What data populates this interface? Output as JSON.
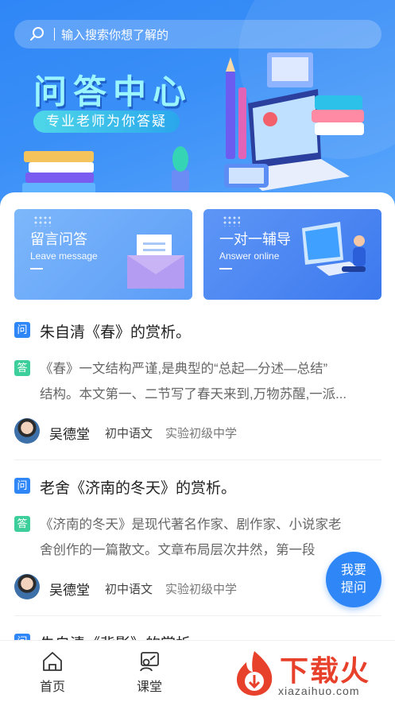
{
  "search": {
    "placeholder": "输入搜索你想了解的"
  },
  "hero": {
    "title": "问答中心",
    "subtitle": "专业老师为你答疑"
  },
  "entries": [
    {
      "title": "留言问答",
      "subtitle": "Leave message"
    },
    {
      "title": "一对一辅导",
      "subtitle": "Answer online"
    }
  ],
  "badges": {
    "ask": "问",
    "answer": "答"
  },
  "questions": [
    {
      "title": "朱自清《春》的赏析。",
      "answer_line1": "《春》一文结构严谨,是典型的“总起—分述—总结”",
      "answer_line2": "结构。本文第一、二节写了春天来到,万物苏醒,一派...",
      "teacher": "吴德堂",
      "subject": "初中语文",
      "school": "实验初级中学"
    },
    {
      "title": "老舍《济南的冬天》的赏析。",
      "answer_line1": "《济南的冬天》是现代著名作家、剧作家、小说家老",
      "answer_line2": "舍创作的一篇散文。文章布局层次井然，第一段",
      "teacher": "吴德堂",
      "subject": "初中语文",
      "school": "实验初级中学"
    },
    {
      "title": "朱自清《背影》的赏析"
    }
  ],
  "fab": {
    "line1": "我要",
    "line2": "提问"
  },
  "tabbar": {
    "items": [
      {
        "label": "首页"
      },
      {
        "label": "课堂"
      }
    ]
  },
  "watermark": {
    "text": "下载火",
    "url": "xiazaihuo.com"
  },
  "colors": {
    "primary": "#2f86f6",
    "answer": "#3ccf9b",
    "watermark": "#e8412b"
  }
}
